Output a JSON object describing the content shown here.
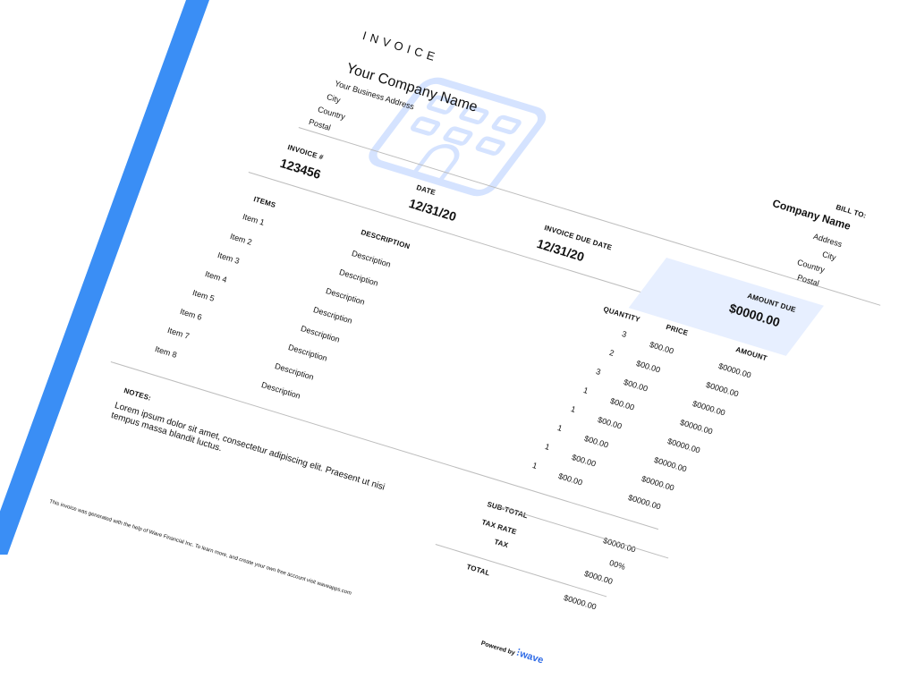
{
  "invoice": {
    "heading": "INVOICE",
    "company": {
      "name": "Your Company Name",
      "address": "Your Business Address",
      "city": "City",
      "country": "Country",
      "postal": "Postal"
    },
    "number_label": "INVOICE #",
    "number": "123456",
    "date_label": "DATE",
    "date": "12/31/20",
    "due_label": "INVOICE DUE DATE",
    "due_date": "12/31/20",
    "bill_to": {
      "label": "BILL TO:",
      "name": "Company Name",
      "address": "Address",
      "city": "City",
      "country": "Country",
      "postal": "Postal"
    },
    "amount_due_label": "AMOUNT DUE",
    "amount_due": "$0000.00",
    "columns": {
      "items": "ITEMS",
      "description": "DESCRIPTION",
      "quantity": "QUANTITY",
      "price": "PRICE",
      "amount": "AMOUNT"
    },
    "items": [
      {
        "name": "Item 1",
        "description": "Description",
        "quantity": "3",
        "price": "$00.00",
        "amount": "$0000.00"
      },
      {
        "name": "Item 2",
        "description": "Description",
        "quantity": "2",
        "price": "$00.00",
        "amount": "$0000.00"
      },
      {
        "name": "Item 3",
        "description": "Description",
        "quantity": "3",
        "price": "$00.00",
        "amount": "$0000.00"
      },
      {
        "name": "Item 4",
        "description": "Description",
        "quantity": "1",
        "price": "$00.00",
        "amount": "$0000.00"
      },
      {
        "name": "Item 5",
        "description": "Description",
        "quantity": "1",
        "price": "$00.00",
        "amount": "$0000.00"
      },
      {
        "name": "Item 6",
        "description": "Description",
        "quantity": "1",
        "price": "$00.00",
        "amount": "$0000.00"
      },
      {
        "name": "Item 7",
        "description": "Description",
        "quantity": "1",
        "price": "$00.00",
        "amount": "$0000.00"
      },
      {
        "name": "Item 8",
        "description": "Description",
        "quantity": "1",
        "price": "$00.00",
        "amount": "$0000.00"
      }
    ],
    "notes_label": "NOTES:",
    "notes_line1": "Lorem ipsum dolor sit amet, consectetur adipiscing elit. Praesent ut nisi",
    "notes_line2": "tempus massa blandit luctus.",
    "subtotal_label": "SUB-TOTAL",
    "subtotal": "$0000.00",
    "tax_rate_label": "TAX RATE",
    "tax_rate": "00%",
    "tax_label": "TAX",
    "tax": "$000.00",
    "total_label": "TOTAL",
    "total": "$0000.00",
    "footer_text": "This invoice was generated with the help of Wave Financial Inc. To learn more, and create your own free account visit waveapps.com",
    "powered_by": "Powered by",
    "brand": "wave"
  },
  "colors": {
    "accent": "#3a8ef5",
    "amount_box": "#e7efff",
    "logo": "#d5e3ff"
  },
  "icons": {
    "logo": "building-icon",
    "brand": "wave-logo-icon"
  }
}
